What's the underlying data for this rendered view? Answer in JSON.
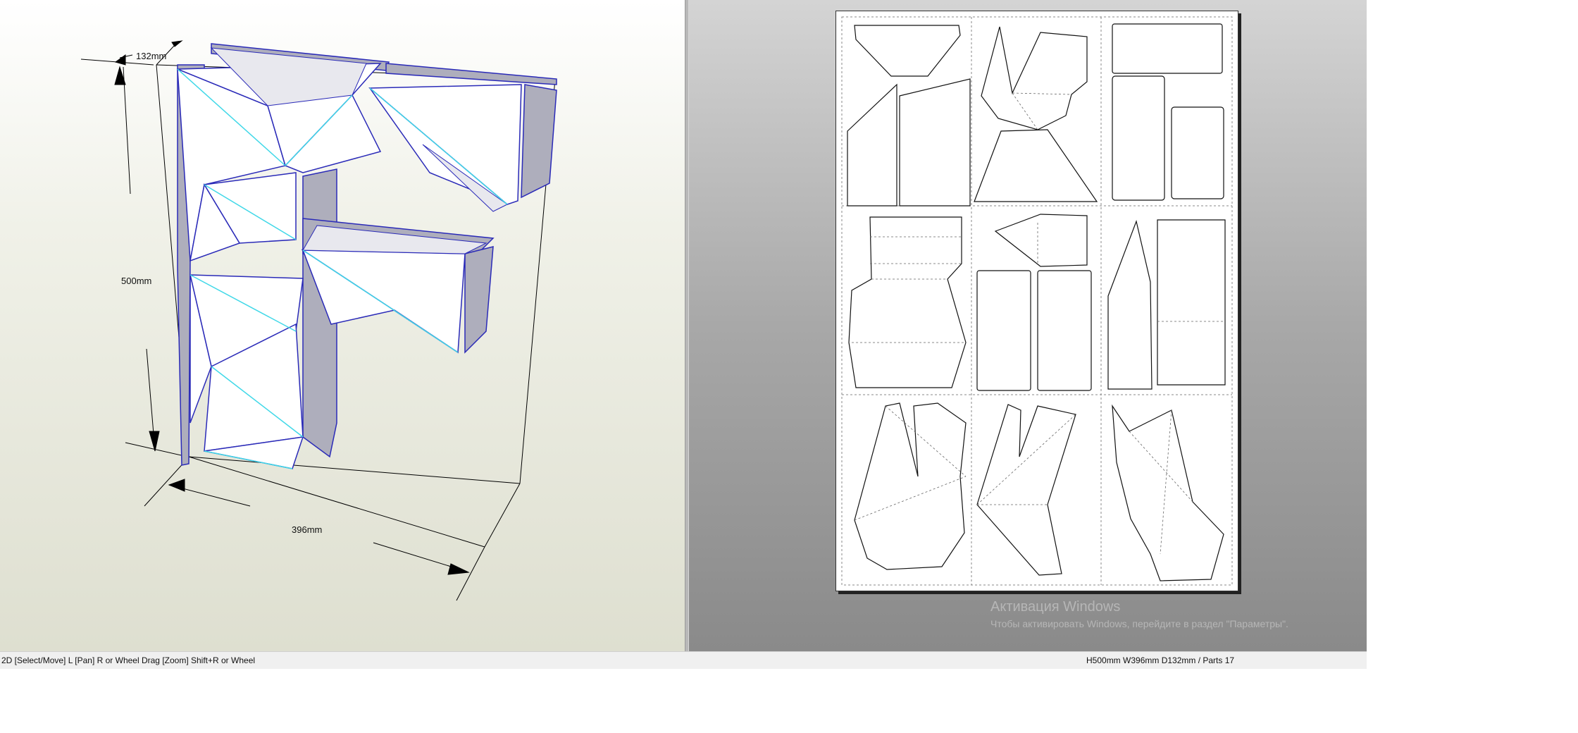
{
  "viewport_3d": {
    "dim_depth": "132mm",
    "dim_height": "500mm",
    "dim_width": "396mm"
  },
  "statusbar": {
    "left_hint": "2D [Select/Move] L [Pan] R or Wheel Drag [Zoom] Shift+R or Wheel",
    "right_info": "H500mm W396mm D132mm / Parts 17"
  },
  "watermark": {
    "title": "Активация Windows",
    "subtitle": "Чтобы активировать Windows, перейдите в раздел \"Параметры\"."
  },
  "colors": {
    "face_white": "#ffffff",
    "face_gray": "#b0b0bc",
    "edge_blue": "#2a2ab8",
    "fold_cyan": "#40d8e8",
    "bg_3d": "#eeeee4",
    "bg_2d": "#a0a0a0"
  }
}
